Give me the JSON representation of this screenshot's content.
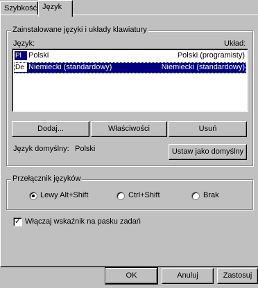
{
  "tabs": [
    {
      "label": "Szybkość"
    },
    {
      "label": "Język"
    }
  ],
  "installed_group": {
    "title": "Zainstalowane języki i układy klawiatury",
    "col_language": "Język:",
    "col_layout": "Układ:",
    "rows": [
      {
        "code": "Pl",
        "name": "Polski",
        "layout": "Polski (programisty)",
        "selected": false
      },
      {
        "code": "De",
        "name": "Niemiecki (standardowy)",
        "layout": "Niemiecki (standardowy)",
        "selected": true
      }
    ],
    "buttons": {
      "add": "Dodaj...",
      "properties": "Właściwości",
      "remove": "Usuń"
    },
    "default_label": "Język domyślny:",
    "default_value": "Polski",
    "set_default": "Ustaw jako domyślny"
  },
  "switch_group": {
    "title": "Przełącznik języków",
    "options": [
      {
        "label": "Lewy Alt+Shift",
        "selected": true
      },
      {
        "label": "Ctrl+Shift",
        "selected": false
      },
      {
        "label": "Brak",
        "selected": false
      }
    ]
  },
  "taskbar_indicator": {
    "label": "Włączaj wskaźnik na pasku zadań",
    "checked": true
  },
  "dialog_buttons": {
    "ok": "OK",
    "cancel": "Anuluj",
    "apply": "Zastosuj"
  },
  "colors": {
    "face": "#c0c0c0",
    "selection": "#000080"
  }
}
